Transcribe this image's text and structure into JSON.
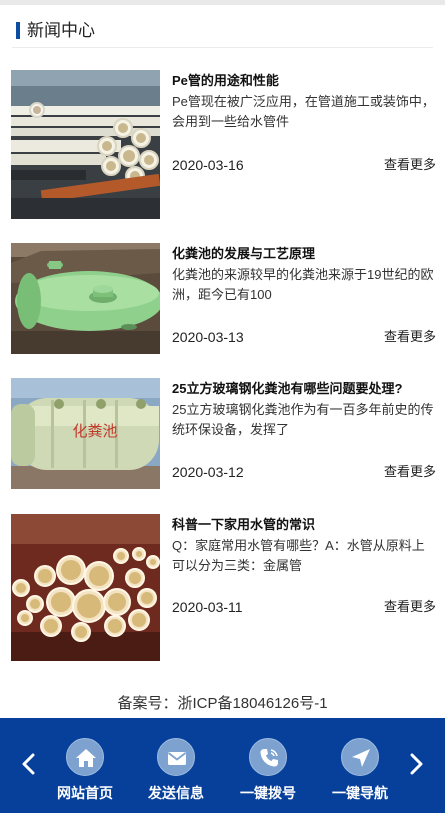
{
  "section": {
    "title": "新闻中心"
  },
  "news": [
    {
      "title": "Pe管的用途和性能",
      "summary": "Pe管现在被广泛应用，在管道施工或装饰中，会用到一些给水管件",
      "date": "2020-03-16",
      "more": "查看更多",
      "image": "white-pe-pipes"
    },
    {
      "title": "化粪池的发展与工艺原理",
      "summary": "化粪池的来源较早的化粪池来源于19世纪的欧洲，距今已有100",
      "date": "2020-03-13",
      "more": "查看更多",
      "image": "green-septic-tank"
    },
    {
      "title": "25立方玻璃钢化粪池有哪些问题要处理?",
      "summary": "25立方玻璃钢化粪池作为有一百多年前史的传统环保设备，发挥了",
      "date": "2020-03-12",
      "more": "查看更多",
      "image": "frp-septic-tank",
      "image_text": "化粪池"
    },
    {
      "title": "科普一下家用水管的常识",
      "summary": "Q：家庭常用水管有哪些？A：水管从原料上可以分为三类：金属管",
      "date": "2020-03-11",
      "more": "查看更多",
      "image": "pvc-pipes-stack"
    }
  ],
  "footer": {
    "icp": "备案号：浙ICP备18046126号-1"
  },
  "bottom_nav": {
    "prev_icon": "chevron-left-icon",
    "next_icon": "chevron-right-icon",
    "items": [
      {
        "label": "网站首页",
        "icon": "home-icon"
      },
      {
        "label": "发送信息",
        "icon": "mail-icon"
      },
      {
        "label": "一键拨号",
        "icon": "phone-icon"
      },
      {
        "label": "一键导航",
        "icon": "navigation-icon"
      }
    ]
  },
  "colors": {
    "brand": "#07409a",
    "accent_bar": "#0a4da2",
    "nav_circle": "#7da2cf"
  }
}
